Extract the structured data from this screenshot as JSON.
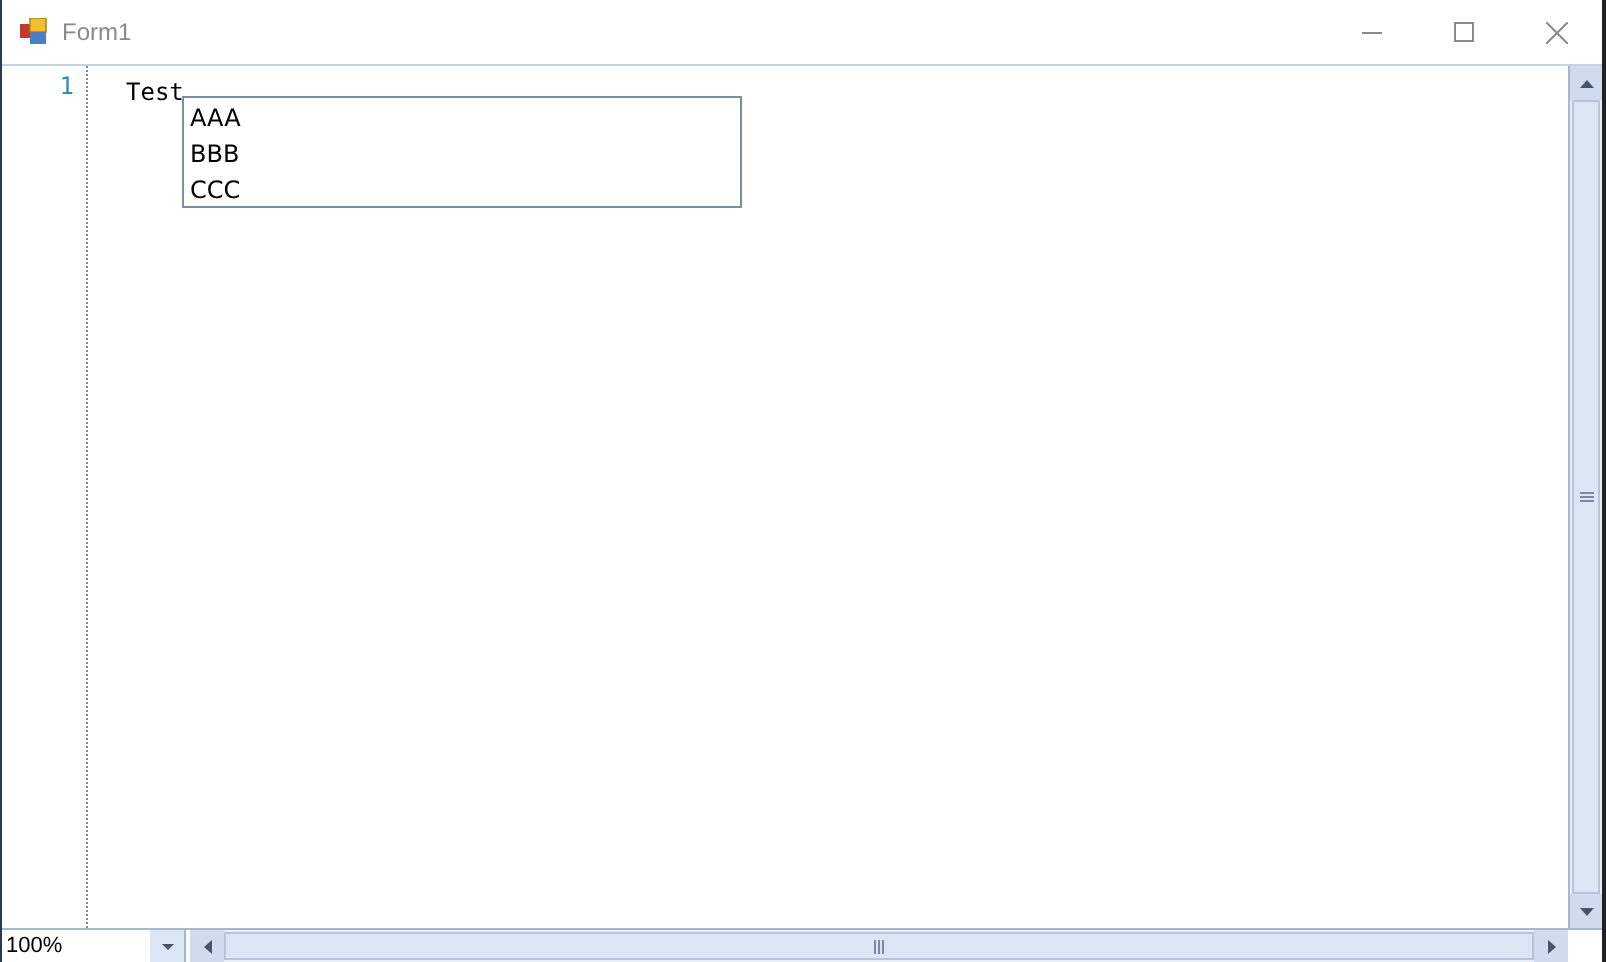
{
  "window": {
    "title": "Form1"
  },
  "editor": {
    "lines": [
      {
        "number": "1",
        "text": "Test"
      }
    ]
  },
  "autocomplete": {
    "items": [
      {
        "text": "AAA"
      },
      {
        "text": "BBB"
      },
      {
        "text": "CCC"
      }
    ]
  },
  "zoom": {
    "value": "100%"
  }
}
